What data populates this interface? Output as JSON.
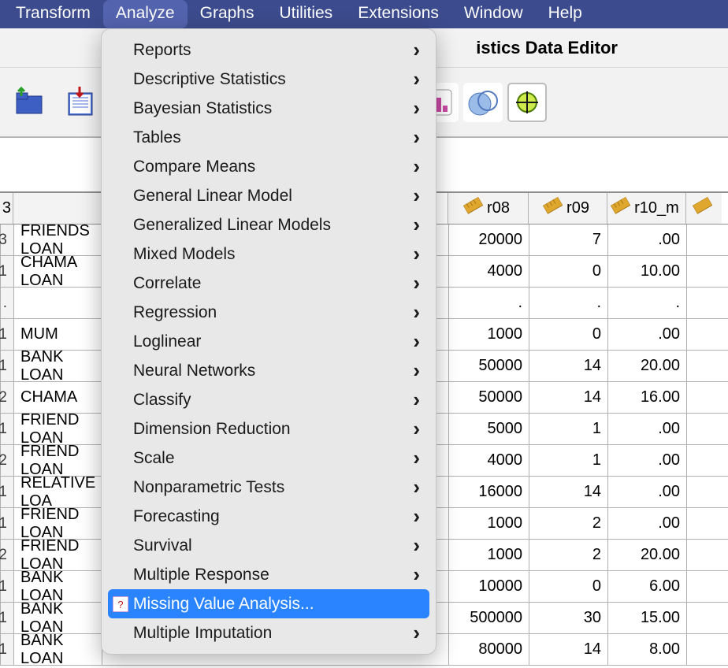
{
  "menubar": {
    "items": [
      "Transform",
      "Analyze",
      "Graphs",
      "Utilities",
      "Extensions",
      "Window",
      "Help"
    ],
    "open_index": 1
  },
  "window": {
    "title_fragment": "istics Data Editor"
  },
  "dropdown": {
    "items": [
      {
        "label": "Reports",
        "submenu": true
      },
      {
        "label": "Descriptive Statistics",
        "submenu": true
      },
      {
        "label": "Bayesian Statistics",
        "submenu": true
      },
      {
        "label": "Tables",
        "submenu": true
      },
      {
        "label": "Compare Means",
        "submenu": true
      },
      {
        "label": "General Linear Model",
        "submenu": true
      },
      {
        "label": "Generalized Linear Models",
        "submenu": true
      },
      {
        "label": "Mixed Models",
        "submenu": true
      },
      {
        "label": "Correlate",
        "submenu": true
      },
      {
        "label": "Regression",
        "submenu": true
      },
      {
        "label": "Loglinear",
        "submenu": true
      },
      {
        "label": "Neural Networks",
        "submenu": true
      },
      {
        "label": "Classify",
        "submenu": true
      },
      {
        "label": "Dimension Reduction",
        "submenu": true
      },
      {
        "label": "Scale",
        "submenu": true
      },
      {
        "label": "Nonparametric Tests",
        "submenu": true
      },
      {
        "label": "Forecasting",
        "submenu": true
      },
      {
        "label": "Survival",
        "submenu": true
      },
      {
        "label": "Multiple Response",
        "submenu": true
      },
      {
        "label": "Missing Value Analysis...",
        "submenu": false,
        "highlight": true,
        "icon": true
      },
      {
        "label": "Multiple Imputation",
        "submenu": true
      }
    ]
  },
  "columns": {
    "idx_fragment": "3",
    "r08": "r08",
    "r09": "r09",
    "r10": "r10_m"
  },
  "rows": [
    {
      "idx": "3",
      "label": "FRIENDS LOAN",
      "r08": "20000",
      "r09": "7",
      "r10": ".00"
    },
    {
      "idx": "1",
      "label": "CHAMA LOAN",
      "r08": "4000",
      "r09": "0",
      "r10": "10.00"
    },
    {
      "idx": ".",
      "label": "",
      "r08": ".",
      "r09": ".",
      "r10": "."
    },
    {
      "idx": "1",
      "label": "MUM",
      "r08": "1000",
      "r09": "0",
      "r10": ".00"
    },
    {
      "idx": "1",
      "label": "BANK LOAN",
      "r08": "50000",
      "r09": "14",
      "r10": "20.00"
    },
    {
      "idx": "2",
      "label": "CHAMA",
      "r08": "50000",
      "r09": "14",
      "r10": "16.00"
    },
    {
      "idx": "1",
      "label": "FRIEND LOAN",
      "r08": "5000",
      "r09": "1",
      "r10": ".00"
    },
    {
      "idx": "2",
      "label": "FRIEND LOAN",
      "r08": "4000",
      "r09": "1",
      "r10": ".00"
    },
    {
      "idx": "1",
      "label": "RELATIVE LOA",
      "r08": "16000",
      "r09": "14",
      "r10": ".00"
    },
    {
      "idx": "1",
      "label": "FRIEND LOAN",
      "r08": "1000",
      "r09": "2",
      "r10": ".00"
    },
    {
      "idx": "2",
      "label": "FRIEND LOAN",
      "r08": "1000",
      "r09": "2",
      "r10": "20.00"
    },
    {
      "idx": "1",
      "label": "BANK LOAN",
      "r08": "10000",
      "r09": "0",
      "r10": "6.00"
    },
    {
      "idx": "1",
      "label": "BANK LOAN",
      "r08": "500000",
      "r09": "30",
      "r10": "15.00"
    },
    {
      "idx": "1",
      "label": "BANK LOAN",
      "r08": "80000",
      "r09": "14",
      "r10": "8.00"
    }
  ]
}
